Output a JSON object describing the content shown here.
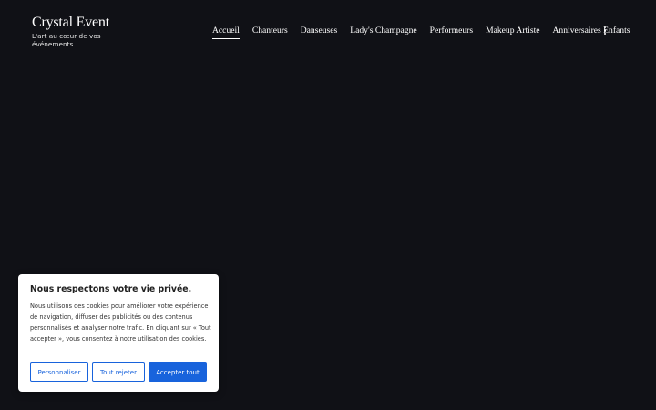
{
  "header": {
    "brand_title": "Crystal Event",
    "brand_tagline": "L'art au cœur de vos événements",
    "nav": [
      {
        "label": "Accueil",
        "active": true
      },
      {
        "label": "Chanteurs",
        "active": false
      },
      {
        "label": "Danseuses",
        "active": false
      },
      {
        "label": "Lady's Champagne",
        "active": false
      },
      {
        "label": "Performeurs",
        "active": false
      },
      {
        "label": "Makeup Artiste",
        "active": false
      },
      {
        "label": "Anniversaires Enfants",
        "active": false
      }
    ],
    "more_icon": "vertical-dots-icon"
  },
  "cookie_banner": {
    "title": "Nous respectons votre vie privée.",
    "text": "Nous utilisons des cookies pour améliorer votre expérience de navigation, diffuser des publicités ou des contenus personnalisés et analyser notre trafic. En cliquant sur « Tout accepter », vous consentez à notre utilisation des cookies.",
    "customize_label": "Personnaliser",
    "reject_label": "Tout rejeter",
    "accept_label": "Accepter tout"
  },
  "colors": {
    "page_background": "#101116",
    "accent": "#1863dc"
  }
}
